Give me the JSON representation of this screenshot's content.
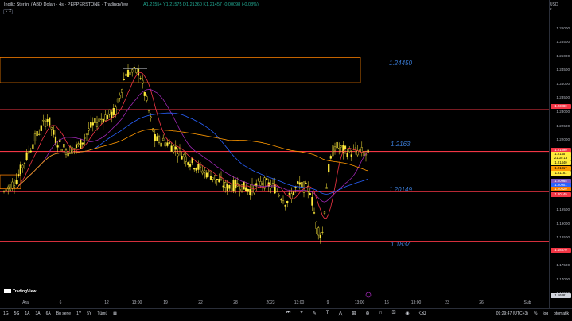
{
  "legend": {
    "title": "İngiliz Sterlini / ABD Doları · 4s · PEPPERSTONE · TradingView",
    "ohlc": "A1.21554 Y1.21575 D1.21360 K1.21457 -0.00098 (-0.08%)",
    "toggle": "⌄ 2"
  },
  "price_scale": {
    "currency": "USD ▾",
    "labels": [
      "1.26000",
      "1.25500",
      "1.25000",
      "1.24500",
      "1.24000",
      "1.23500",
      "1.23000",
      "1.22500",
      "1.22000",
      "1.21500",
      "1.21000",
      "1.20500",
      "1.20000",
      "1.19500",
      "1.19000",
      "1.18500",
      "1.18000",
      "1.17500",
      "1.17000",
      "1.16500"
    ],
    "tags": [
      {
        "text": "1.23080",
        "color": "#f23645",
        "fg": "#ffffff"
      },
      {
        "text": "1.21590",
        "color": "#f23645",
        "fg": "#ffffff"
      },
      {
        "text": "1.21457",
        "color": "#ffeb3b",
        "fg": "#000000"
      },
      {
        "text": "21:30:13",
        "color": "#ffeb3b",
        "fg": "#000000"
      },
      {
        "text": "1.21440",
        "color": "#ffeb3b",
        "fg": "#000000"
      },
      {
        "text": "1.21317",
        "color": "#ff9800",
        "fg": "#000000"
      },
      {
        "text": "1.21181",
        "color": "#ffeb3b",
        "fg": "#000000"
      },
      {
        "text": "1.20965",
        "color": "#7e57c2",
        "fg": "#ffffff"
      },
      {
        "text": "1.20901",
        "color": "#2962ff",
        "fg": "#ffffff"
      },
      {
        "text": "1.20620",
        "color": "#f57c00",
        "fg": "#ffffff"
      },
      {
        "text": "1.20149",
        "color": "#f23645",
        "fg": "#ffffff"
      },
      {
        "text": "1.18370",
        "color": "#f23645",
        "fg": "#ffffff"
      },
      {
        "text": "1.16881",
        "color": "#d1d4dc",
        "fg": "#000000"
      }
    ]
  },
  "horizontal_lines": [
    {
      "label": "1.24450",
      "value": 1.2445
    },
    {
      "label": "",
      "value": 1.2308
    },
    {
      "label": "1.2163",
      "value": 1.2159
    },
    {
      "label": "1.20149",
      "value": 1.20149
    },
    {
      "label": "1.1837",
      "value": 1.1837
    }
  ],
  "time_axis": [
    "Ara",
    "6",
    "12",
    "13:00",
    "19",
    "22",
    "28",
    "2023",
    "13:00",
    "9",
    "13:00",
    "16",
    "13:00",
    "23",
    "26",
    "Şub"
  ],
  "watermark": "TradingView",
  "bottom_bar": {
    "ranges": [
      "1G",
      "5G",
      "1A",
      "3A",
      "6A",
      "Bu sene",
      "1Y",
      "5Y",
      "Tümü"
    ],
    "range_icon": "calendar-icon",
    "clock": "09:29:47 (UTC+3)",
    "right_items": [
      "%",
      "log",
      "otomatik"
    ]
  },
  "chart_data": {
    "type": "candlestick",
    "title": "İngiliz Sterlini / ABD Doları · 4s · PEPPERSTONE",
    "ylim": [
      1.1655,
      1.2625
    ],
    "x_ticks": [
      "Ara",
      "6",
      "12",
      "13:00",
      "19",
      "22",
      "28",
      "2023",
      "13:00",
      "9",
      "13:00",
      "16",
      "13:00",
      "23",
      "26",
      "Şub"
    ],
    "last_close": 1.21457,
    "colors": {
      "candle": "#ffeb3b",
      "ma_fast": "#f23645",
      "ma_mid": "#9c27b0",
      "ma_slow": "#2962ff",
      "ma_long": "#ff9800",
      "zone": "#f57c00"
    }
  }
}
